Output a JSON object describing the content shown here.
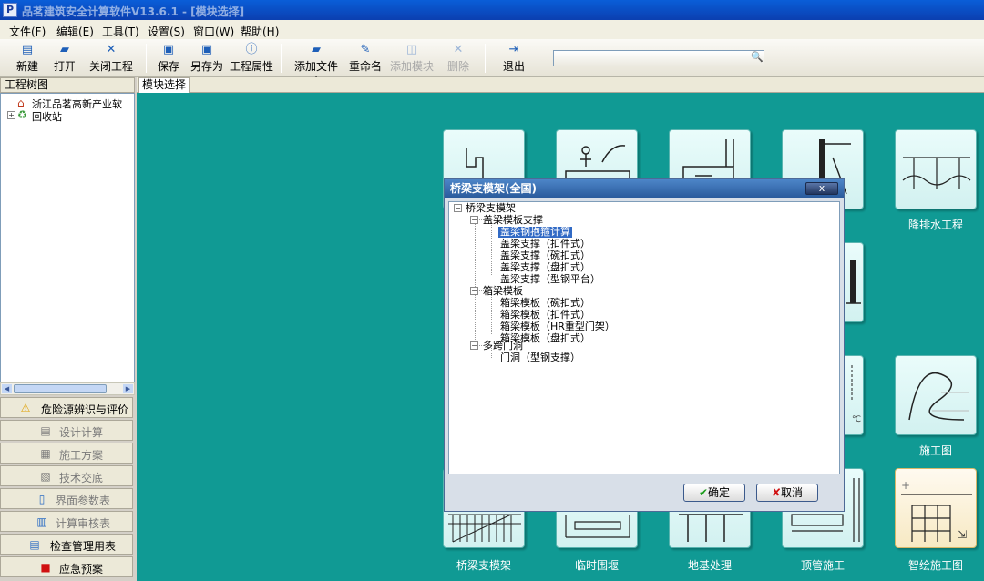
{
  "window": {
    "title": "品茗建筑安全计算软件V13.6.1 - [模块选择]",
    "app_icon": "P"
  },
  "menu": [
    "文件(F)",
    "编辑(E)",
    "工具(T)",
    "设置(S)",
    "窗口(W)",
    "帮助(H)"
  ],
  "toolbar": {
    "new": "新建",
    "open": "打开",
    "close_project": "关闭工程",
    "save": "保存",
    "save_as": "另存为",
    "project_props": "工程属性",
    "add_folder": "添加文件夹",
    "rename": "重命名",
    "add_module": "添加模块",
    "delete": "删除",
    "exit": "退出"
  },
  "search": {
    "value": ""
  },
  "left": {
    "header": "工程树图",
    "tree": [
      "浙江品茗高新产业软",
      "回收站"
    ],
    "panels": [
      "危险源辨识与评价",
      "设计计算",
      "施工方案",
      "技术交底",
      "界面参数表",
      "计算审核表",
      "检查管理用表",
      "应急预案"
    ]
  },
  "tab": "模块选择",
  "modules": {
    "drainage": "降排水工程",
    "construction_drawing": "施工图",
    "bridge_support": "桥梁支模架",
    "cofferdam": "临时围堰",
    "foundation": "地基处理",
    "pipe_jacking": "顶管施工",
    "smart_drawing": "智绘施工图"
  },
  "dialog": {
    "title": "桥梁支模架(全国)",
    "root": "桥梁支模架",
    "group1": "盖梁模板支撑",
    "g1_items": [
      "盖梁钢抱箍计算",
      "盖梁支撑（扣件式）",
      "盖梁支撑（碗扣式）",
      "盖梁支撑（盘扣式）",
      "盖梁支撑（型钢平台）"
    ],
    "group2": "箱梁模板",
    "g2_items": [
      "箱梁模板（碗扣式）",
      "箱梁模板（扣件式）",
      "箱梁模板（HR重型门架）",
      "箱梁模板（盘扣式）"
    ],
    "group3": "多跨门洞",
    "g3_items": [
      "门洞（型钢支撑）"
    ],
    "ok": "确定",
    "cancel": "取消",
    "close": "x"
  }
}
